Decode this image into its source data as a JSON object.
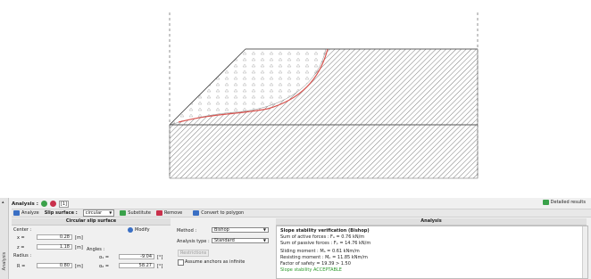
{
  "colors": {
    "accent": "#3a6fc4",
    "ok": "#2c9a2c",
    "curve": "#d9534f",
    "green_icon": "#3aa14a",
    "red_icon": "#c9304b"
  },
  "panel": {
    "side_tab_label": "Analysis",
    "title": "Analysis :",
    "stage_value": "[1]",
    "detailed_results_label": "Detailed results",
    "toolbar": {
      "analyze_label": "Analyze",
      "slip_surface_label": "Slip surface :",
      "slip_surface_value": "circular",
      "substitute_label": "Substitute",
      "remove_label": "Remove",
      "convert_label": "Convert to polygon"
    },
    "circular": {
      "header": "Circular slip surface",
      "center_label": "Center :",
      "modify_label": "Modify",
      "x_label": "x =",
      "x_value": "0.28",
      "z_label": "z =",
      "z_value": "1.18",
      "unit_m": "[m]",
      "radius_label": "Radius :",
      "r_label": "R =",
      "r_value": "0.80",
      "angles_label": "Angles :",
      "a1_label": "α₁ =",
      "a1_value": "-9.04",
      "a2_label": "α₂ =",
      "a2_value": "58.27",
      "unit_deg": "[°]"
    },
    "method": {
      "method_label": "Method :",
      "method_value": "Bishop",
      "type_label": "Analysis type :",
      "type_value": "Standard",
      "restrictions_label": "Restrictions",
      "anchors_label": "Assume anchors as infinite"
    },
    "analysis": {
      "header": "Analysis",
      "title": "Slope stability verification (Bishop)",
      "active": "Sum of active forces :   Fₐ =   0.76 kN/m",
      "passive": "Sum of passive forces :  Fₚ =  14.76 kN/m",
      "sliding": "Sliding moment :      Mₐ =   0.61 kNm/m",
      "resisting": "Resisting moment :   Mₚ =  11.85 kNm/m",
      "factor": "Factor of safety = 19.39 > 1.50",
      "result": "Slope stability ACCEPTABLE"
    }
  }
}
